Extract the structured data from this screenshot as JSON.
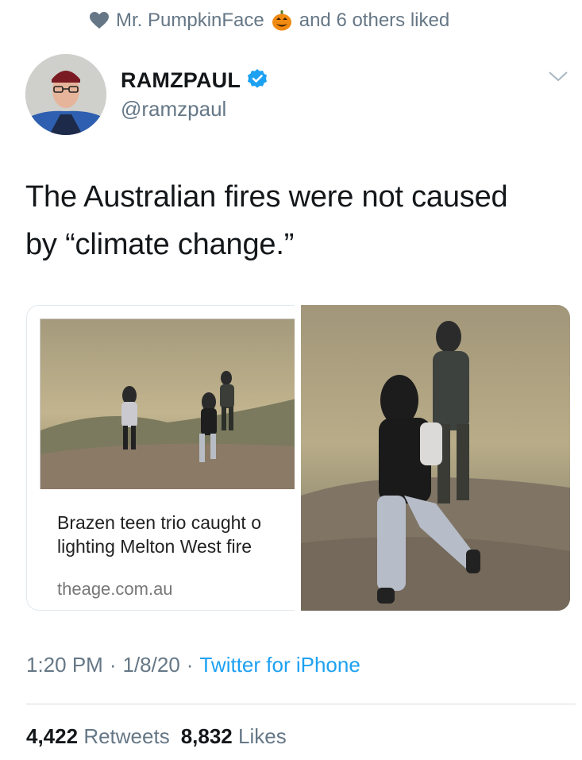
{
  "social_context": {
    "liker_name": "Mr. PumpkinFace",
    "others_text": "and 6 others liked",
    "heart_icon": "heart-icon",
    "pumpkin_icon": "jack-o-lantern-icon"
  },
  "author": {
    "display_name": "RAMZPAUL",
    "handle": "@ramzpaul",
    "verified_icon": "verified-badge-icon"
  },
  "tweet": {
    "text_line1": "The Australian fires were not caused",
    "text_line2": "by “climate change.”"
  },
  "link_card": {
    "title_line1": "Brazen teen trio caught o",
    "title_line2": "lighting Melton West fire",
    "domain": "theage.com.au"
  },
  "meta": {
    "time": "1:20 PM",
    "date": "1/8/20",
    "source": "Twitter for iPhone",
    "separator": "·"
  },
  "stats": {
    "retweets_count": "4,422",
    "retweets_label": "Retweets",
    "likes_count": "8,832",
    "likes_label": "Likes"
  },
  "colors": {
    "accent": "#1da1f2",
    "secondary_text": "#657786",
    "primary_text": "#14171a"
  }
}
